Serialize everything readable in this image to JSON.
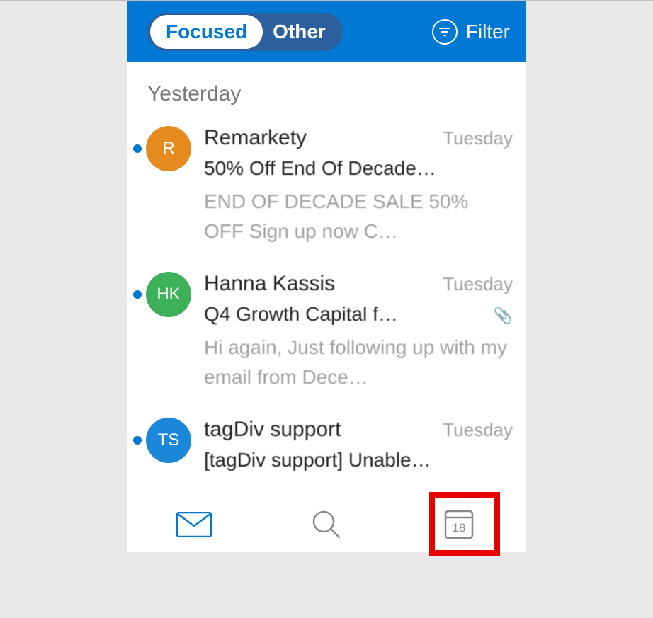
{
  "topbar": {
    "tab_focused": "Focused",
    "tab_other": "Other",
    "filter_label": "Filter"
  },
  "section_header": "Yesterday",
  "emails": [
    {
      "avatar_initials": "R",
      "avatar_color": "avatar-orange",
      "sender": "Remarkety",
      "timestamp": "Tuesday",
      "subject": "50% Off End Of Decade…",
      "preview": "END OF DECADE SALE 50% OFF Sign up now C…",
      "has_attachment": false
    },
    {
      "avatar_initials": "HK",
      "avatar_color": "avatar-green",
      "sender": "Hanna Kassis",
      "timestamp": "Tuesday",
      "subject": "Q4 Growth Capital f…",
      "preview": "Hi again, Just following up with my email from Dece…",
      "has_attachment": true
    },
    {
      "avatar_initials": "TS",
      "avatar_color": "avatar-blue",
      "sender": "tagDiv support",
      "timestamp": "Tuesday",
      "subject": "[tagDiv support] Unable…",
      "preview": "",
      "has_attachment": false
    }
  ],
  "nav": {
    "calendar_day": "18"
  }
}
